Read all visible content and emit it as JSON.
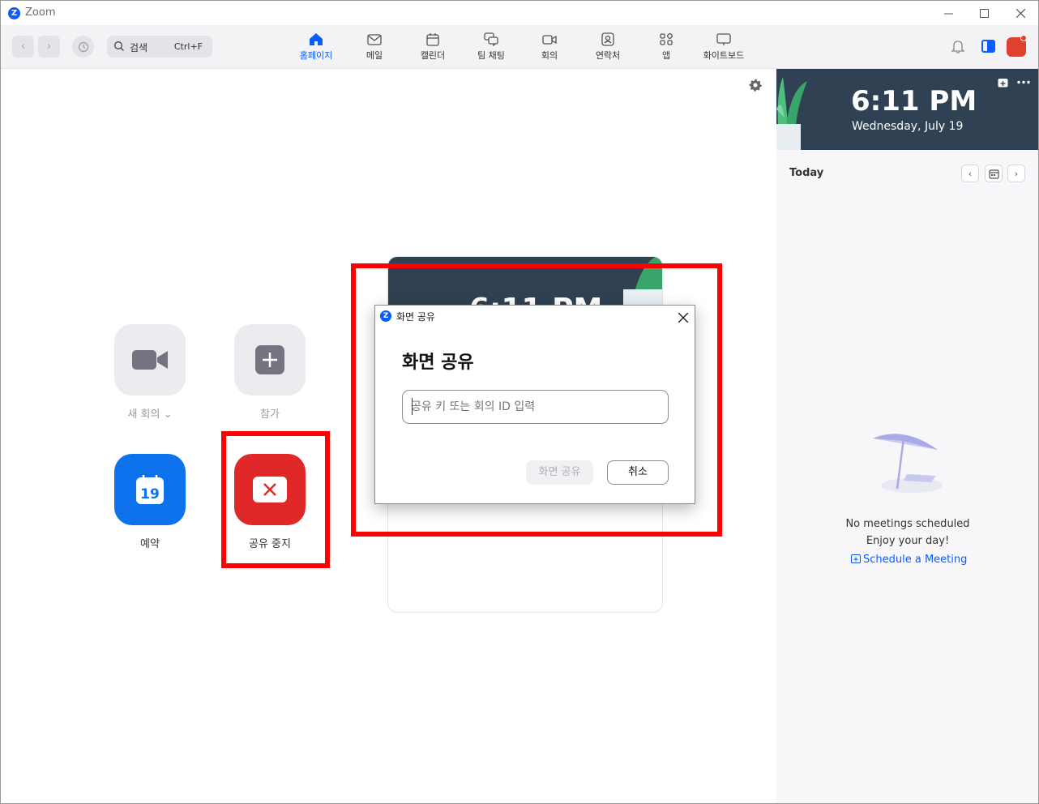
{
  "window": {
    "title": "Zoom",
    "logo_letter": "Z"
  },
  "toolbar": {
    "search_label": "검색",
    "search_shortcut": "Ctrl+F",
    "tabs": [
      {
        "label": "홈페이지",
        "icon": "home-icon",
        "active": true
      },
      {
        "label": "메일",
        "icon": "mail-icon"
      },
      {
        "label": "캘린더",
        "icon": "calendar-icon"
      },
      {
        "label": "팀 채팅",
        "icon": "chat-icon"
      },
      {
        "label": "회의",
        "icon": "video-icon"
      },
      {
        "label": "연락처",
        "icon": "contacts-icon"
      },
      {
        "label": "앱",
        "icon": "apps-icon"
      },
      {
        "label": "화이트보드",
        "icon": "whiteboard-icon"
      }
    ]
  },
  "home": {
    "actions": {
      "new_meeting": "새 회의",
      "join": "참가",
      "schedule": "예약",
      "schedule_day": "19",
      "stop_share": "공유 중지"
    },
    "card_time": "6:11 PM"
  },
  "dialog": {
    "title": "화면 공유",
    "heading": "화면 공유",
    "input_placeholder": "공유 키 또는 회의 ID 입력",
    "input_value": "",
    "share_button": "화면 공유",
    "cancel_button": "취소"
  },
  "sidebar": {
    "time": "6:11 PM",
    "date": "Wednesday, July 19",
    "today_label": "Today",
    "empty_line1": "No meetings scheduled",
    "empty_line2": "Enjoy your day!",
    "schedule_link": "Schedule a Meeting"
  },
  "colors": {
    "accent": "#0b5cff",
    "stop_share": "#e02828",
    "schedule_tile": "#0e72ed",
    "highlight": "#ff0000",
    "banner": "#2f4152"
  }
}
